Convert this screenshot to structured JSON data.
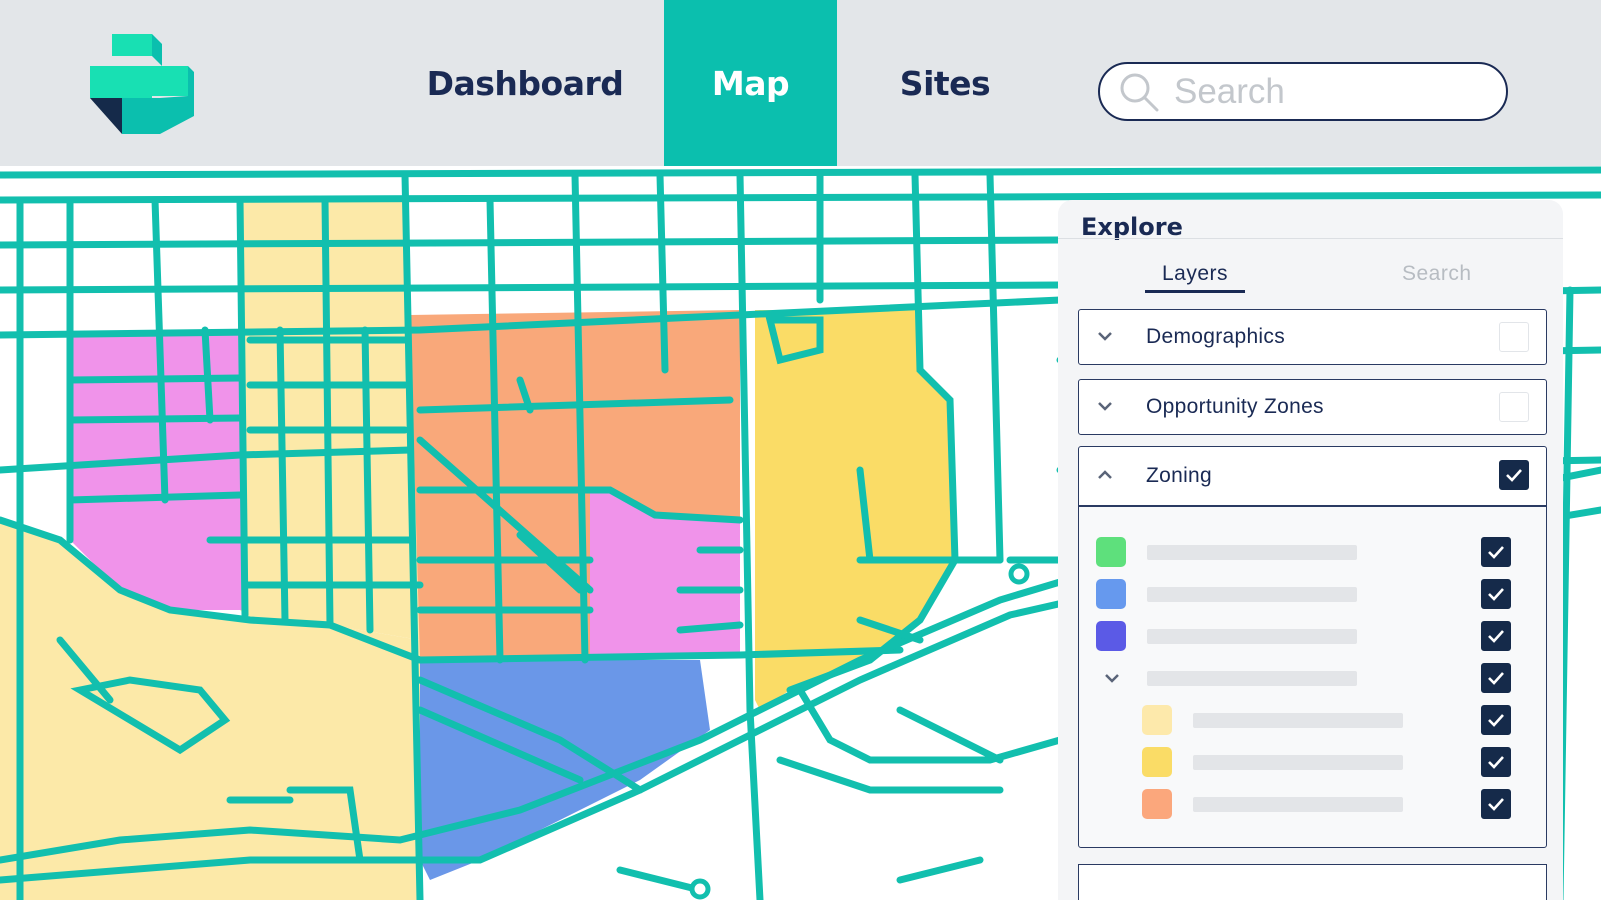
{
  "colors": {
    "road": "#12bfae",
    "accent": "#0bbfae",
    "navy": "#1a2a54",
    "zone_pink": "#f093ea",
    "zone_light_yellow": "#fce9a8",
    "zone_orange": "#f9a87a",
    "zone_yellow": "#fadc66",
    "zone_blue": "#6a97e8"
  },
  "nav": {
    "items": [
      {
        "label": "Dashboard",
        "active": false
      },
      {
        "label": "Map",
        "active": true
      },
      {
        "label": "Sites",
        "active": false
      }
    ],
    "search_placeholder": "Search",
    "search_icon": "search-icon",
    "logo": "brand-logo"
  },
  "panel": {
    "title": "Explore",
    "tabs": [
      {
        "label": "Layers",
        "active": true
      },
      {
        "label": "Search",
        "active": false
      }
    ],
    "layers": [
      {
        "label": "Demographics",
        "expanded": false,
        "checked": false,
        "icon": "chevron-down-icon"
      },
      {
        "label": "Opportunity Zones",
        "expanded": false,
        "checked": false,
        "icon": "chevron-down-icon"
      },
      {
        "label": "Zoning",
        "expanded": true,
        "checked": true,
        "icon": "chevron-up-icon"
      }
    ],
    "zoning_items": [
      {
        "swatch": "#5ee07c",
        "checked": true
      },
      {
        "swatch": "#6699ee",
        "checked": true
      },
      {
        "swatch": "#5b5ae6",
        "checked": true
      },
      {
        "group": true,
        "icon": "chevron-down-icon",
        "checked": true
      },
      {
        "swatch": "#fde9ab",
        "checked": true,
        "indent": true
      },
      {
        "swatch": "#fadc66",
        "checked": true,
        "indent": true
      },
      {
        "swatch": "#fba77c",
        "checked": true,
        "indent": true
      }
    ]
  }
}
